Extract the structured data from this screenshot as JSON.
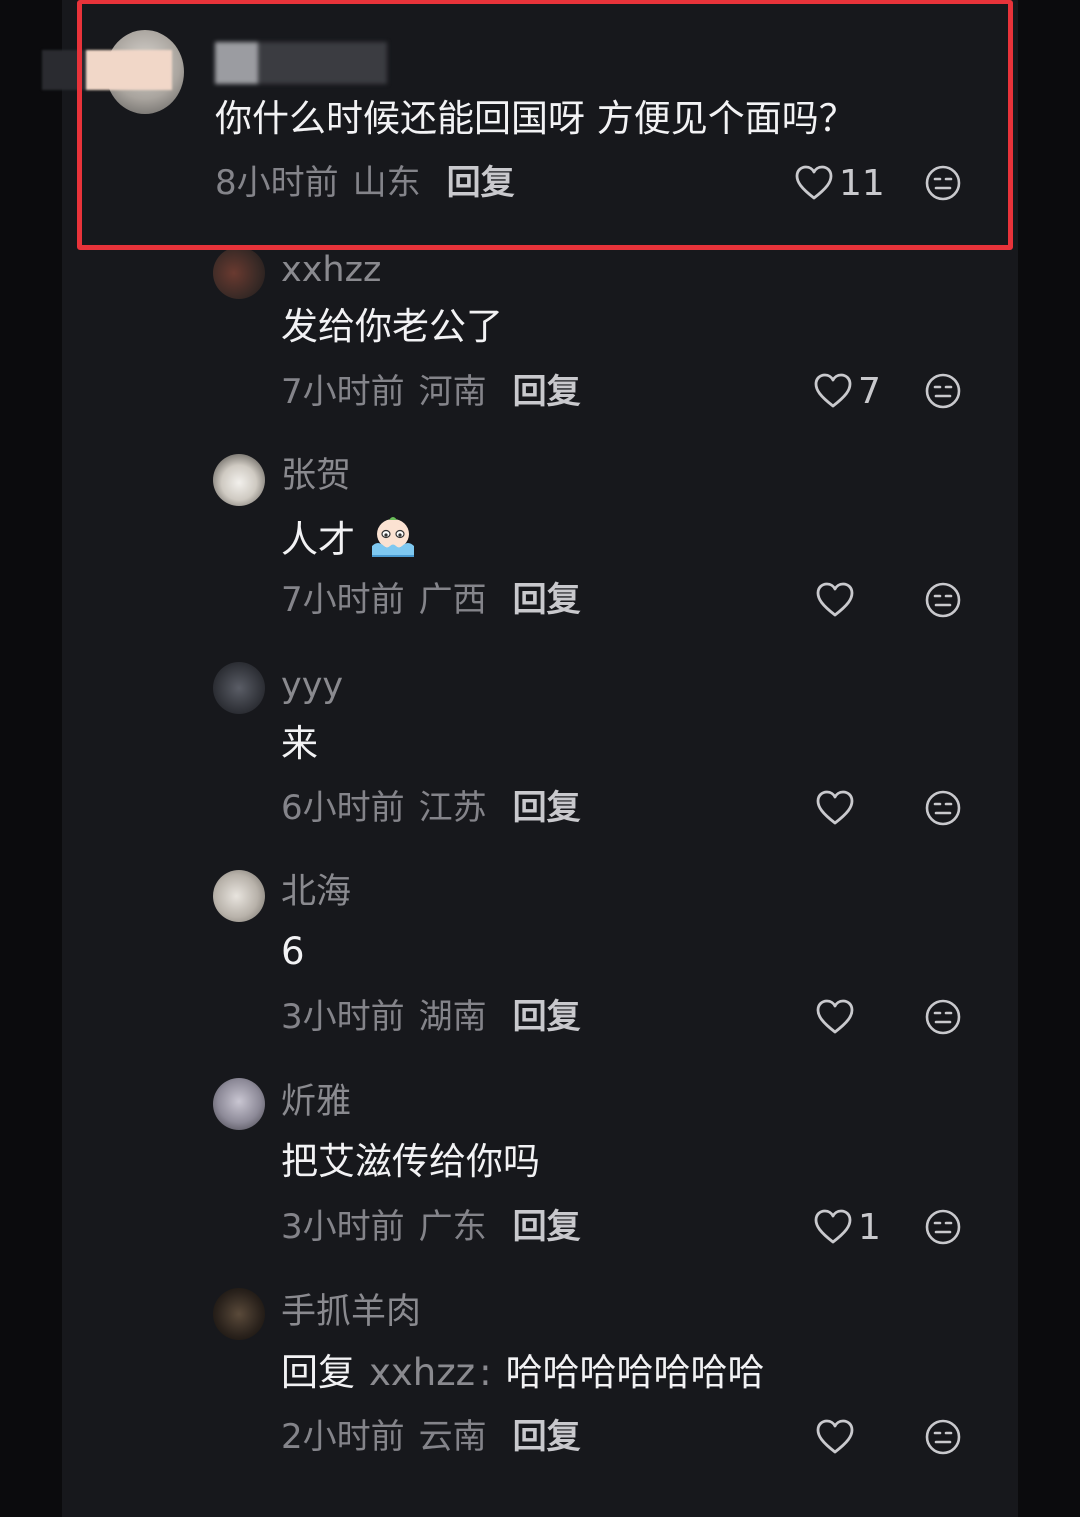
{
  "comments": [
    {
      "username": "",
      "content": "你什么时候还能回国呀 方便见个面吗？",
      "time": "8小时前",
      "region": "山东",
      "reply_label": "回复",
      "likes": "11"
    },
    {
      "username": "xxhzz",
      "content": "发给你老公了",
      "time": "7小时前",
      "region": "河南",
      "reply_label": "回复",
      "likes": "7"
    },
    {
      "username": "张贺",
      "content": "人才",
      "time": "7小时前",
      "region": "广西",
      "reply_label": "回复",
      "likes": ""
    },
    {
      "username": "yyy",
      "content": "来",
      "time": "6小时前",
      "region": "江苏",
      "reply_label": "回复",
      "likes": ""
    },
    {
      "username": "北海",
      "content": "6",
      "time": "3小时前",
      "region": "湖南",
      "reply_label": "回复",
      "likes": ""
    },
    {
      "username": "炘雅",
      "content": "把艾滋传给你吗",
      "time": "3小时前",
      "region": "广东",
      "reply_label": "回复",
      "likes": "1"
    },
    {
      "username": "手抓羊肉",
      "content_prefix": "回复",
      "content_target": "xxhzz",
      "content_colon": ":",
      "content": "哈哈哈哈哈哈哈",
      "time": "2小时前",
      "region": "云南",
      "reply_label": "回复",
      "likes": ""
    }
  ],
  "colors": {
    "highlight_border": "#e8333a",
    "background": "#17181c"
  },
  "icons": [
    "heart-icon",
    "more-emoji-icon",
    "crying-emoji-icon"
  ]
}
